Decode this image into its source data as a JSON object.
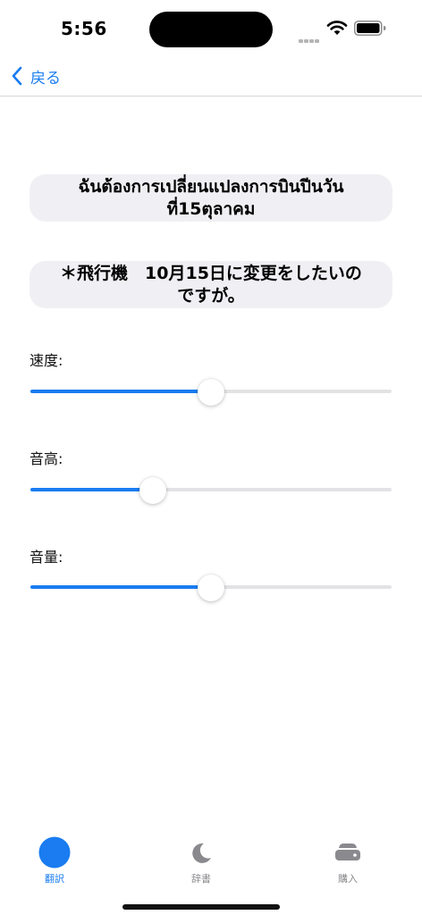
{
  "status_bar": {
    "time": "5:56",
    "icons": [
      "signal-icon",
      "wifi-icon",
      "battery-icon"
    ]
  },
  "nav": {
    "back_label": "戻る",
    "back_icon": "chevron-left-icon"
  },
  "source_text": "ฉันต้องการเปลี่ยนแปลงการบินปีนวันที่15ตุลาคม",
  "translated_text": "＊飛行機　10月15日に変更をしたいのですが。",
  "sliders": [
    {
      "label": "速度:",
      "value": 0.5
    },
    {
      "label": "音高:",
      "value": 0.34
    },
    {
      "label": "音量:",
      "value": 0.5
    }
  ],
  "tab_bar": {
    "tabs": [
      {
        "label": "翻訳",
        "icon": "circle-icon",
        "active": true
      },
      {
        "label": "辞書",
        "icon": "moon-icon",
        "active": false
      },
      {
        "label": "購入",
        "icon": "drive-icon",
        "active": false
      }
    ]
  },
  "colors": {
    "accent": "#1a7cf0",
    "card_background": "#f0f0f4",
    "track_inactive": "#e3e3e6",
    "tab_inactive": "#8a8a8e"
  }
}
